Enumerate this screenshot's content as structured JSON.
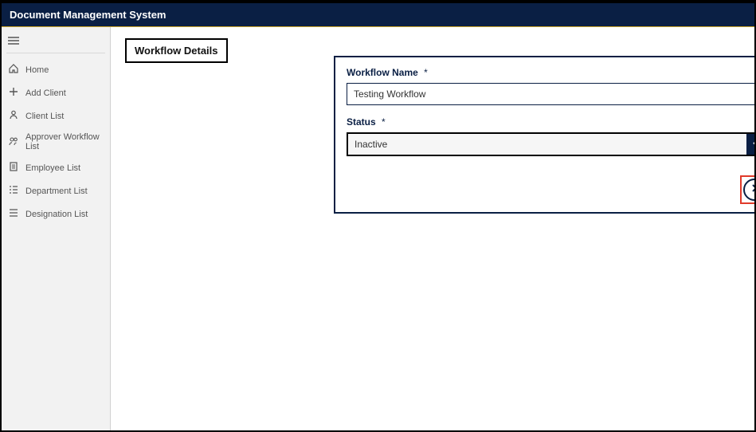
{
  "header": {
    "title": "Document Management System"
  },
  "sidebar": {
    "items": [
      {
        "icon": "home-icon",
        "label": "Home"
      },
      {
        "icon": "plus-icon",
        "label": "Add Client"
      },
      {
        "icon": "person-icon",
        "label": "Client List"
      },
      {
        "icon": "people-icon",
        "label": "Approver Workflow List"
      },
      {
        "icon": "employee-icon",
        "label": "Employee List"
      },
      {
        "icon": "list-indent-icon",
        "label": "Department List"
      },
      {
        "icon": "list-icon",
        "label": "Designation List"
      }
    ]
  },
  "page": {
    "title": "Workflow Details",
    "form": {
      "workflow_name_label": "Workflow Name",
      "workflow_name_value": "Testing Workflow",
      "status_label": "Status",
      "status_value": "Inactive",
      "required_marker": "*"
    }
  }
}
